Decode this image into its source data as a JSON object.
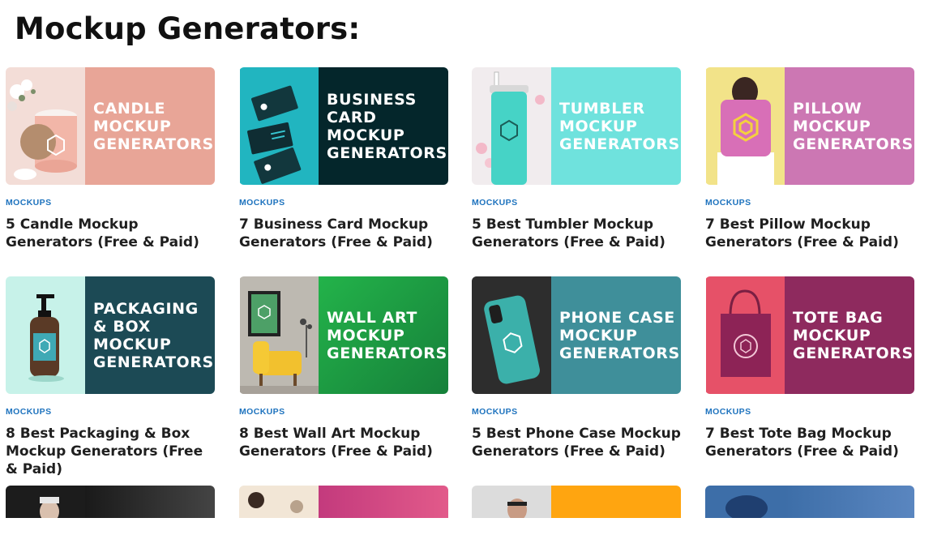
{
  "section": {
    "title": "Mockup Generators:"
  },
  "cards": [
    {
      "category": "MOCKUPS",
      "title": "5 Candle Mockup Generators (Free & Paid)",
      "thumb_lines": [
        "CANDLE",
        "MOCKUP",
        "GENERATORS"
      ],
      "colors": {
        "photo": "#f3d6cf",
        "panel": "#e8a597"
      },
      "icon": "candle-jar-icon"
    },
    {
      "category": "MOCKUPS",
      "title": "7 Business Card Mockup Generators (Free & Paid)",
      "thumb_lines": [
        "BUSINESS",
        "CARD",
        "MOCKUP",
        "GENERATORS"
      ],
      "colors": {
        "photo": "#1fb3bf",
        "panel": "#04262b"
      },
      "icon": "business-cards-icon"
    },
    {
      "category": "MOCKUPS",
      "title": "5 Best Tumbler Mockup Generators (Free & Paid)",
      "thumb_lines": [
        "TUMBLER",
        "MOCKUP",
        "GENERATORS"
      ],
      "colors": {
        "photo": "#eee8ea",
        "panel": "#6fe2dd"
      },
      "icon": "tumbler-icon"
    },
    {
      "category": "MOCKUPS",
      "title": "7 Best Pillow Mockup Generators (Free & Paid)",
      "thumb_lines": [
        "PILLOW",
        "MOCKUP",
        "GENERATORS"
      ],
      "colors": {
        "photo": "#f1e08a",
        "panel": "#cc77b3"
      },
      "icon": "pillow-icon"
    },
    {
      "category": "MOCKUPS",
      "title": "8 Best Packaging & Box Mockup Generators (Free & Paid)",
      "thumb_lines": [
        "PACKAGING",
        "& BOX",
        "MOCKUP",
        "GENERATORS"
      ],
      "colors": {
        "photo": "#c6f1e8",
        "panel": "#1c4a55"
      },
      "icon": "pump-bottle-icon"
    },
    {
      "category": "MOCKUPS",
      "title": "8 Best Wall Art Mockup Generators (Free & Paid)",
      "thumb_lines": [
        "WALL ART",
        "MOCKUP",
        "GENERATORS"
      ],
      "colors": {
        "photo": "#b9b6ae",
        "panel": "#22a542"
      },
      "icon": "framed-art-icon"
    },
    {
      "category": "MOCKUPS",
      "title": "5 Best Phone Case Mockup Generators (Free & Paid)",
      "thumb_lines": [
        "PHONE CASE",
        "MOCKUP",
        "GENERATORS"
      ],
      "colors": {
        "photo": "#2a2a2a",
        "panel": "#3f8f9a"
      },
      "icon": "phone-case-icon"
    },
    {
      "category": "MOCKUPS",
      "title": "7 Best Tote Bag Mockup Generators (Free & Paid)",
      "thumb_lines": [
        "TOTE BAG",
        "MOCKUP",
        "GENERATORS"
      ],
      "colors": {
        "photo": "#e9556a",
        "panel": "#8e2a5e"
      },
      "icon": "tote-bag-icon"
    }
  ],
  "partial_row": [
    {
      "colors": {
        "photo": "#1c1c1c",
        "panel": "#2f2f2f"
      }
    },
    {
      "colors": {
        "photo": "#f2e6d6",
        "panel": "#c33a7d"
      }
    },
    {
      "colors": {
        "photo": "#dcdcdc",
        "panel": "#ffa510"
      }
    },
    {
      "colors": {
        "photo": "#3d6ea8",
        "panel": "#4b78b2"
      }
    }
  ]
}
